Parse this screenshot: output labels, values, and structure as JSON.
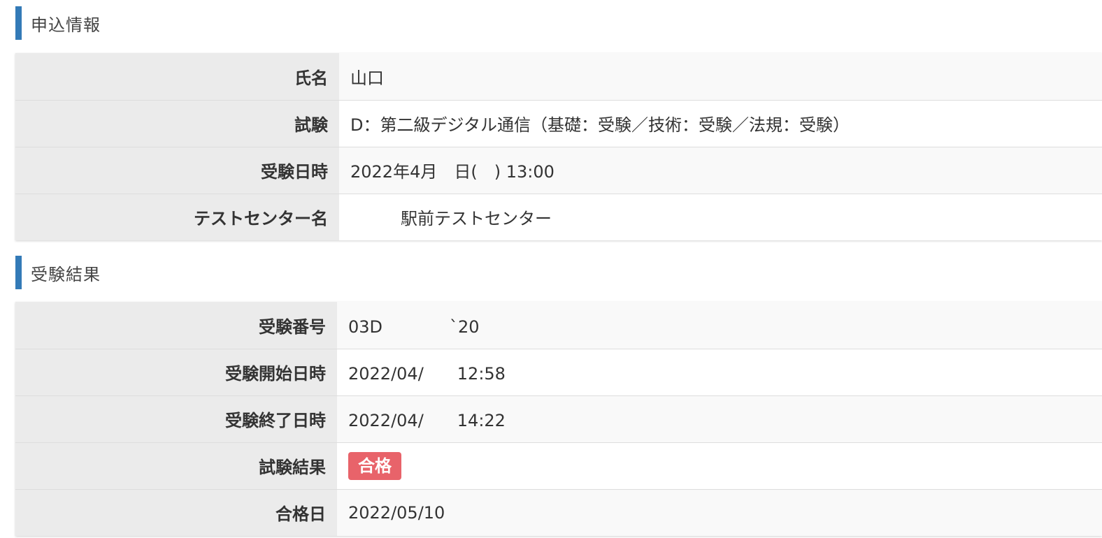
{
  "application_section": {
    "heading": "申込情報",
    "rows": [
      {
        "label": "氏名",
        "value": "山口"
      },
      {
        "label": "試験",
        "value": "D：第二級デジタル通信（基礎：受験／技術：受験／法規：受験）"
      },
      {
        "label": "受験日時",
        "value": "2022年4月　日(　) 13:00"
      },
      {
        "label": "テストセンター名",
        "value": "　　　駅前テストセンター"
      }
    ]
  },
  "results_section": {
    "heading": "受験結果",
    "rows": [
      {
        "label": "受験番号",
        "value": "03D　　　　`20"
      },
      {
        "label": "受験開始日時",
        "value": "2022/04/　　12:58"
      },
      {
        "label": "受験終了日時",
        "value": "2022/04/　　14:22"
      },
      {
        "label": "試験結果",
        "badge": "合格"
      },
      {
        "label": "合格日",
        "value": "2022/05/10"
      }
    ]
  },
  "colors": {
    "accent_bar": "#337ab7",
    "pass_badge": "#e8636a"
  }
}
